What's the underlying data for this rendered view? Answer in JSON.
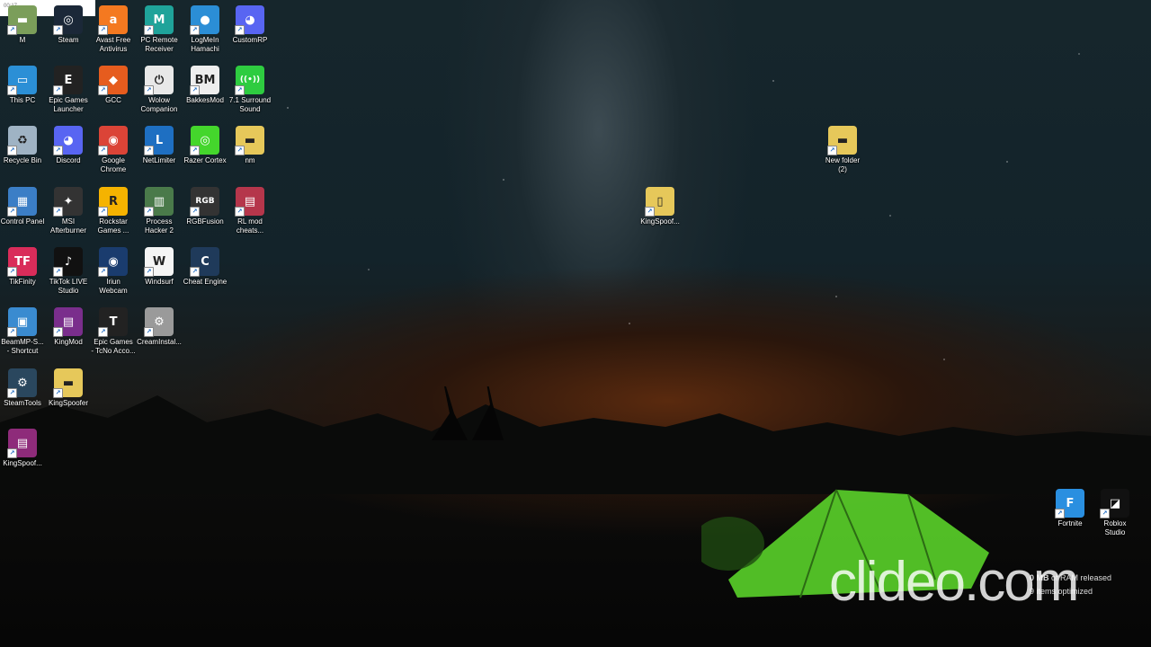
{
  "recording_time": "00:17",
  "watermark": "clideo.com",
  "overlay": {
    "memory": "0 MB",
    "memory_suffix": "of RAM released",
    "items": "9 items optimized"
  },
  "icons_col1": [
    {
      "label": "M",
      "icon": "folder-icon",
      "color": "#7b9e5a"
    },
    {
      "label": "This PC",
      "icon": "computer-icon",
      "color": "#2b8fd6"
    },
    {
      "label": "Recycle Bin",
      "icon": "recycle-bin-icon",
      "color": "#9fb3c4"
    },
    {
      "label": "Control Panel",
      "icon": "control-panel-icon",
      "color": "#3b7ec6"
    },
    {
      "label": "TikFinity",
      "icon": "tikfinity-icon",
      "color": "#d92c5a"
    },
    {
      "label": "BeamMP-S...\n- Shortcut",
      "icon": "beammp-icon",
      "color": "#3a8bd0"
    },
    {
      "label": "SteamTools",
      "icon": "steamtools-icon",
      "color": "#2a475e"
    },
    {
      "label": "KingSpoof...",
      "icon": "rar-archive-icon",
      "color": "#8e2b7a"
    }
  ],
  "icons_col2": [
    {
      "label": "Steam",
      "icon": "steam-icon",
      "color": "#1b2838"
    },
    {
      "label": "Epic Games\nLauncher",
      "icon": "epic-games-icon",
      "color": "#222"
    },
    {
      "label": "Discord",
      "icon": "discord-icon",
      "color": "#5865f2"
    },
    {
      "label": "MSI\nAfterburner",
      "icon": "msi-afterburner-icon",
      "color": "#333"
    },
    {
      "label": "TikTok LIVE\nStudio",
      "icon": "tiktok-icon",
      "color": "#111"
    },
    {
      "label": "KingMod",
      "icon": "rar-archive-icon",
      "color": "#7a2e8c"
    },
    {
      "label": "KingSpoofer",
      "icon": "folder-icon",
      "color": "#e6c85a"
    }
  ],
  "icons_col3": [
    {
      "label": "Avast Free\nAntivirus",
      "icon": "avast-icon",
      "color": "#f47920"
    },
    {
      "label": "GCC",
      "icon": "gcc-icon",
      "color": "#e65c1e"
    },
    {
      "label": "Google\nChrome",
      "icon": "chrome-icon",
      "color": "#db4437"
    },
    {
      "label": "Rockstar\nGames ...",
      "icon": "rockstar-icon",
      "color": "#f5b300"
    },
    {
      "label": "Iriun\nWebcam",
      "icon": "iriun-webcam-icon",
      "color": "#1a3c6e"
    },
    {
      "label": "Epic Games\n- TcNo Acco...",
      "icon": "tcno-icon",
      "color": "#222"
    }
  ],
  "icons_col4": [
    {
      "label": "PC Remote\nReceiver",
      "icon": "pc-remote-icon",
      "color": "#1fa39a"
    },
    {
      "label": "Wolow\nCompanion",
      "icon": "power-icon",
      "color": "#e8e8e8"
    },
    {
      "label": "NetLimiter",
      "icon": "netlimiter-icon",
      "color": "#1e6fc2"
    },
    {
      "label": "Process\nHacker 2",
      "icon": "process-hacker-icon",
      "color": "#4a7a4a"
    },
    {
      "label": "Windsurf",
      "icon": "windsurf-icon",
      "color": "#f5f5f5"
    },
    {
      "label": "CreamInstal...",
      "icon": "gear-icon",
      "color": "#9a9a9a"
    }
  ],
  "icons_col5": [
    {
      "label": "LogMeIn\nHamachi",
      "icon": "hamachi-icon",
      "color": "#2b8ed6"
    },
    {
      "label": "BakkesMod",
      "icon": "bakkesmod-icon",
      "color": "#eee"
    },
    {
      "label": "Razer Cortex",
      "icon": "razer-cortex-icon",
      "color": "#44d62c"
    },
    {
      "label": "RGBFusion",
      "icon": "rgbfusion-icon",
      "color": "#333"
    },
    {
      "label": "Cheat Engine",
      "icon": "cheat-engine-icon",
      "color": "#1f3a5a"
    }
  ],
  "icons_col6": [
    {
      "label": "CustomRP",
      "icon": "discord-icon",
      "color": "#5865f2"
    },
    {
      "label": "7.1 Surround\nSound",
      "icon": "surround-sound-icon",
      "color": "#2ecc40"
    },
    {
      "label": "nm",
      "icon": "folder-icon",
      "color": "#e6c85a"
    },
    {
      "label": "RL mod\ncheats...",
      "icon": "rar-archive-icon",
      "color": "#b5364b"
    }
  ],
  "icons_misc": [
    {
      "label": "New folder\n(2)",
      "icon": "folder-icon",
      "color": "#e6c85a"
    },
    {
      "label": "KingSpoof...",
      "icon": "file-icon",
      "color": "#e6c85a"
    },
    {
      "label": "Fortnite",
      "icon": "fortnite-icon",
      "color": "#2a8fe0"
    },
    {
      "label": "Roblox\nStudio",
      "icon": "roblox-studio-icon",
      "color": "#111"
    }
  ]
}
